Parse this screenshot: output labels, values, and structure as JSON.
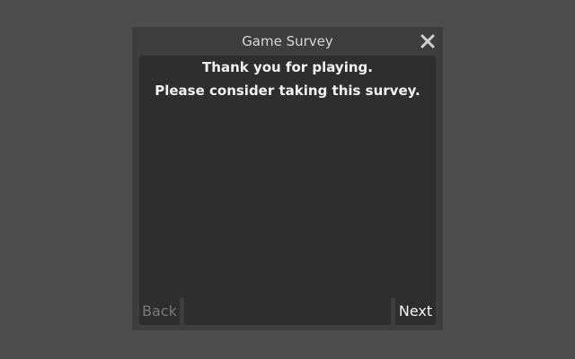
{
  "dialog": {
    "title": "Game Survey",
    "close_icon": "close-icon"
  },
  "content": {
    "line1": "Thank you for playing.",
    "line2": "Please consider taking this survey."
  },
  "footer": {
    "back_label": "Back",
    "next_label": "Next",
    "back_enabled": false
  },
  "colors": {
    "background": "#4d4d4d",
    "dialog": "#3e3e3e",
    "panel": "#2e2e2e",
    "text": "#f2f2f2",
    "disabled_text": "#7a7a7a"
  }
}
